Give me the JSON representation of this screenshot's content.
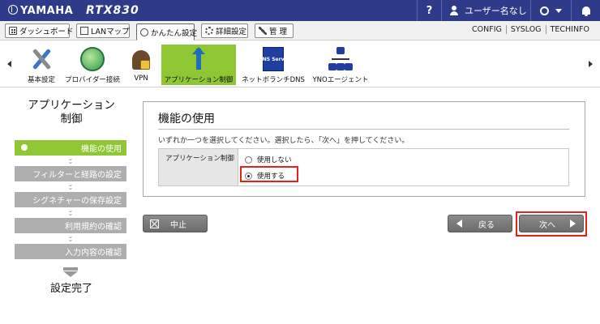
{
  "header": {
    "brand": "YAMAHA",
    "model": "RTX830",
    "help": "?",
    "user": "ユーザー名なし",
    "icons": [
      "yamaha-logo-icon",
      "user-icon",
      "status-ring-icon",
      "chevron-down-icon",
      "bell-icon"
    ]
  },
  "nav": {
    "tabs": [
      {
        "label": "ダッシュボード",
        "icon": "dashboard-icon"
      },
      {
        "label": "LANマップ",
        "icon": "lan-map-icon"
      },
      {
        "label": "かんたん設定",
        "icon": "wizard-icon"
      },
      {
        "label": "詳細設定",
        "icon": "gear-icon"
      },
      {
        "label": "管 理",
        "icon": "wrench-icon"
      }
    ],
    "links": [
      "CONFIG",
      "SYSLOG",
      "TECHINFO"
    ]
  },
  "menu": {
    "items": [
      {
        "label": "基本設定",
        "icon": "tools-icon"
      },
      {
        "label": "プロバイダー接続",
        "icon": "globe-icon"
      },
      {
        "label": "VPN",
        "icon": "vpn-icon"
      },
      {
        "label": "アプリケーション制御",
        "icon": "application-control-icon"
      },
      {
        "label": "ネットボランチDNS",
        "icon": "ddns-icon",
        "icon_text": "DDNS Service"
      },
      {
        "label": "YNOエージェント",
        "icon": "yno-agent-icon"
      }
    ]
  },
  "sidebar": {
    "title_line1": "アプリケーション",
    "title_line2": "制御",
    "steps": [
      "機能の使用",
      "フィルターと経路の設定",
      "シグネチャーの保存設定",
      "利用規約の確認",
      "入力内容の確認"
    ],
    "done": "設定完了"
  },
  "panel": {
    "title": "機能の使用",
    "instruction": "いずれか一つを選択してください。選択したら、「次へ」を押してください。",
    "field_label": "アプリケーション制御",
    "options": [
      {
        "label": "使用しない",
        "selected": false
      },
      {
        "label": "使用する",
        "selected": true
      }
    ]
  },
  "buttons": {
    "cancel": "中止",
    "back": "戻る",
    "next": "次へ"
  },
  "colors": {
    "header_bg": "#2f3b89",
    "accent_green": "#8ec634",
    "highlight_red": "#e8201c",
    "button_gray": "#7a7a7a"
  }
}
